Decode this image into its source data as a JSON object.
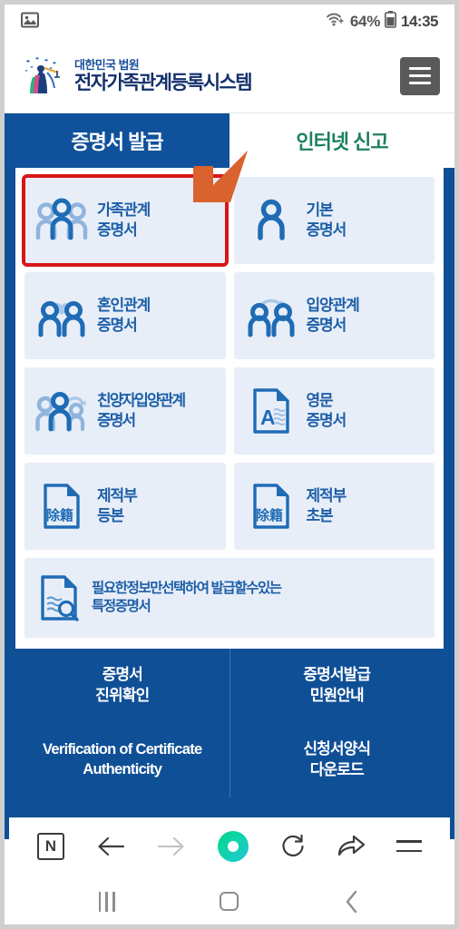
{
  "statusbar": {
    "image_icon": "image-icon",
    "wifi_icon": "wifi-icon",
    "battery_percent": "64%",
    "battery_icon": "battery-icon",
    "time": "14:35"
  },
  "header": {
    "logo_alt": "korean-court-logo",
    "org_small": "대한민국 법원",
    "org_big": "전자가족관계등록시스템",
    "menu_label": "hamburger-menu"
  },
  "tabs": [
    {
      "label": "증명서 발급",
      "active": true
    },
    {
      "label": "인터넷 신고",
      "active": false
    }
  ],
  "annotation": {
    "arrow": "down-left-arrow",
    "color": "#d9622f"
  },
  "certificates": [
    {
      "icon": "three-people-icon",
      "line1": "가족관계",
      "line2": "증명서",
      "selected": true
    },
    {
      "icon": "single-person-icon",
      "line1": "기본",
      "line2": "증명서",
      "selected": false
    },
    {
      "icon": "couple-heart-icon",
      "line1": "혼인관계",
      "line2": "증명서",
      "selected": false
    },
    {
      "icon": "couple-arrow-icon",
      "line1": "입양관계",
      "line2": "증명서",
      "selected": false
    },
    {
      "icon": "family-arrow-icon",
      "line1": "친양자입양관계",
      "line2": "증명서",
      "selected": false
    },
    {
      "icon": "document-a-icon",
      "line1": "영문",
      "line2": "증명서",
      "selected": false
    },
    {
      "icon": "document-jejeok-icon",
      "line1": "제적부",
      "line2": "등본",
      "selected": false
    },
    {
      "icon": "document-jejeok-icon",
      "line1": "제적부",
      "line2": "초본",
      "selected": false
    }
  ],
  "special_certificate": {
    "icon": "document-search-icon",
    "line1": "필요한정보만선택하여 발급할수있는",
    "line2": "특정증명서"
  },
  "bottom_links": [
    {
      "line1": "증명서",
      "line2": "진위확인",
      "lang": "ko"
    },
    {
      "line1": "증명서발급",
      "line2": "민원안내",
      "lang": "ko"
    },
    {
      "line1": "Verification of Certificate",
      "line2": "Authenticity",
      "lang": "en"
    },
    {
      "line1": "신청서양식",
      "line2": "다운로드",
      "lang": "ko"
    }
  ],
  "browser_bar": {
    "naver_logo": "N",
    "back_icon": "back-arrow-icon",
    "forward_icon": "forward-arrow-icon",
    "home_icon": "whale-home-icon",
    "reload_icon": "reload-icon",
    "share_icon": "share-icon",
    "menu_icon": "menu-icon"
  },
  "android_nav": {
    "recents_icon": "recents-icon",
    "home_icon": "home-icon",
    "back_icon": "back-icon"
  },
  "colors": {
    "primary_blue": "#0f4f96",
    "tab_active": "#10519b",
    "tab_inactive_text": "#1d8063",
    "tile_bg": "#e8eef8",
    "tile_text": "#1c5ea8",
    "highlight_red": "#d81616",
    "arrow_orange": "#d9622f"
  }
}
